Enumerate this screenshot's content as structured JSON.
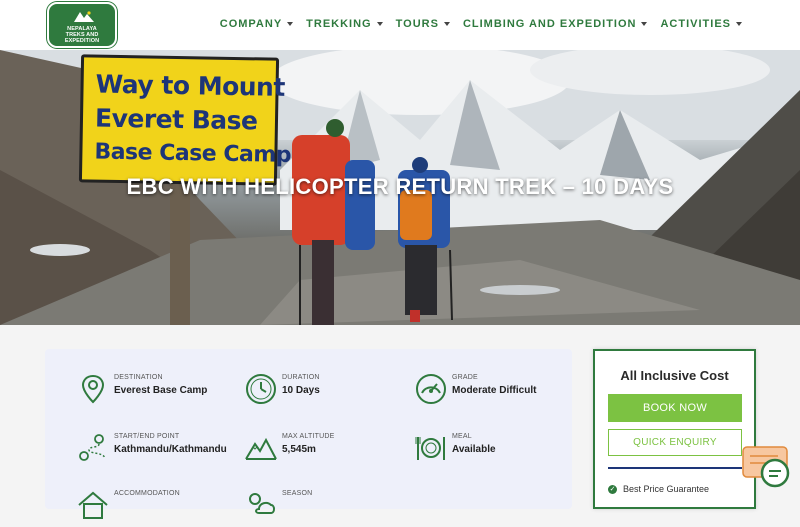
{
  "logo": {
    "lines": [
      "NEPALAYA",
      "TREKS AND",
      "EXPEDITION"
    ]
  },
  "nav": {
    "items": [
      {
        "label": "COMPANY"
      },
      {
        "label": "TREKKING"
      },
      {
        "label": "TOURS"
      },
      {
        "label": "CLIMBING AND EXPEDITION"
      },
      {
        "label": "ACTIVITIES"
      }
    ]
  },
  "hero": {
    "title": "EBC WITH HELICOPTER RETURN TREK – 10 DAYS",
    "sign_lines": [
      "Way to Mount",
      "Everet Base",
      "Base Case Camp"
    ]
  },
  "facts": [
    {
      "label": "DESTINATION",
      "value": "Everest Base Camp",
      "icon": "map-pin-icon"
    },
    {
      "label": "DURATION",
      "value": "10 Days",
      "icon": "clock-icon"
    },
    {
      "label": "GRADE",
      "value": "Moderate Difficult",
      "icon": "gauge-icon"
    },
    {
      "label": "START/END POINT",
      "value": "Kathmandu/Kathmandu",
      "icon": "route-icon"
    },
    {
      "label": "MAX ALTITUDE",
      "value": "5,545m",
      "icon": "mountain-icon"
    },
    {
      "label": "MEAL",
      "value": "Available",
      "icon": "meal-icon"
    },
    {
      "label": "ACCOMMODATION",
      "value": "",
      "icon": "house-icon"
    },
    {
      "label": "SEASON",
      "value": "",
      "icon": "season-icon"
    }
  ],
  "cost": {
    "title": "All Inclusive Cost",
    "book_label": "BOOK NOW",
    "enquiry_label": "QUICK ENQUIRY",
    "guarantee": "Best Price Guarantee"
  },
  "colors": {
    "brand_green": "#2f7a3e",
    "button_green": "#7cc242",
    "sign_yellow": "#f1d31a",
    "sign_text": "#1d3578"
  }
}
